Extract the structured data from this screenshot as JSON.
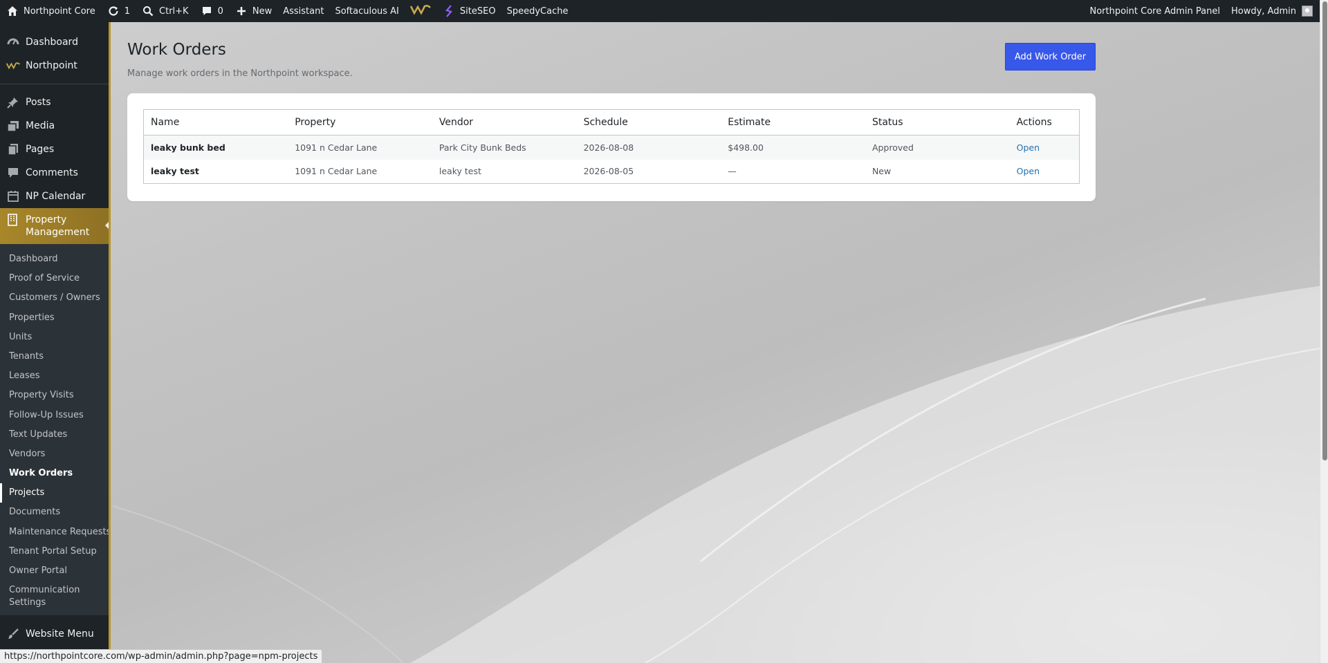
{
  "adminbar": {
    "site_name": "Northpoint Core",
    "updates_count": "1",
    "search_shortcut": "Ctrl+K",
    "comments_count": "0",
    "new_label": "New",
    "assistant_label": "Assistant",
    "softaculous_label": "Softaculous AI",
    "siteseo_label": "SiteSEO",
    "speedycache_label": "SpeedyCache",
    "panel_label": "Northpoint Core Admin Panel",
    "howdy_label": "Howdy, Admin"
  },
  "sidebar": {
    "top_items": [
      {
        "label": "Dashboard",
        "icon": "dashboard-icon"
      },
      {
        "label": "Northpoint",
        "icon": "northpoint-logo-icon"
      }
    ],
    "main_items": [
      {
        "label": "Posts",
        "icon": "pin-icon"
      },
      {
        "label": "Media",
        "icon": "media-icon"
      },
      {
        "label": "Pages",
        "icon": "pages-icon"
      },
      {
        "label": "Comments",
        "icon": "comment-icon"
      },
      {
        "label": "NP Calendar",
        "icon": "calendar-icon"
      }
    ],
    "active_item": {
      "label_line1": "Property",
      "label_line2": "Management",
      "icon": "building-icon"
    },
    "submenu": [
      "Dashboard",
      "Proof of Service",
      "Customers / Owners",
      "Properties",
      "Units",
      "Tenants",
      "Leases",
      "Property Visits",
      "Follow-Up Issues",
      "Text Updates",
      "Vendors",
      "Work Orders",
      "Projects",
      "Documents",
      "Maintenance Requests",
      "Tenant Portal Setup",
      "Owner Portal",
      "Communication Settings"
    ],
    "current_submenu": "Work Orders",
    "bottom_item": {
      "label": "Website Menu",
      "icon": "brush-icon"
    }
  },
  "page": {
    "title": "Work Orders",
    "subtitle": "Manage work orders in the Northpoint workspace.",
    "add_button": "Add Work Order"
  },
  "table": {
    "columns": [
      "Name",
      "Property",
      "Vendor",
      "Schedule",
      "Estimate",
      "Status",
      "Actions"
    ],
    "rows": [
      {
        "name": "leaky bunk bed",
        "property": "1091 n Cedar Lane",
        "vendor": "Park City Bunk Beds",
        "schedule": "2026-08-08",
        "estimate": "$498.00",
        "status": "Approved",
        "action": "Open"
      },
      {
        "name": "leaky test",
        "property": "1091 n Cedar Lane",
        "vendor": "leaky test",
        "schedule": "2026-08-05",
        "estimate": "—",
        "status": "New",
        "action": "Open"
      }
    ]
  },
  "statusbar": {
    "url": "https://northpointcore.com/wp-admin/admin.php?page=npm-projects"
  },
  "colors": {
    "accent": "#b8962e",
    "primary_button": "#3858e9",
    "link": "#2271b1",
    "adminbar_bg": "#1d2327"
  }
}
